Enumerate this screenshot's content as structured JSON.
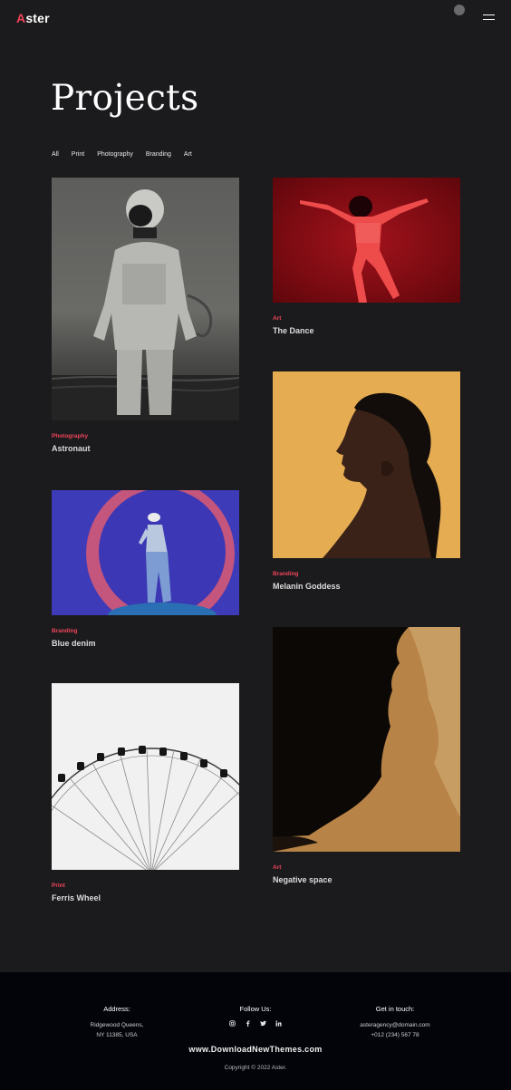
{
  "header": {
    "logo_first": "A",
    "logo_rest": "ster"
  },
  "page": {
    "title": "Projects"
  },
  "filters": [
    "All",
    "Print",
    "Photography",
    "Branding",
    "Art"
  ],
  "projects": [
    {
      "category": "Photography",
      "name": "Astronaut"
    },
    {
      "category": "Art",
      "name": "The Dance"
    },
    {
      "category": "Branding",
      "name": "Melanin Goddess"
    },
    {
      "category": "Branding",
      "name": "Blue denim"
    },
    {
      "category": "Print",
      "name": "Ferris Wheel"
    },
    {
      "category": "Art",
      "name": "Negative space"
    }
  ],
  "footer": {
    "address": {
      "heading": "Address:",
      "line1": "Ridgewood Queens,",
      "line2": "NY 11385, USA"
    },
    "follow": {
      "heading": "Follow Us:"
    },
    "contact": {
      "heading": "Get in touch:",
      "email": "asteragency@domain.com",
      "phone": "+012 (234) 567 78"
    },
    "watermark": "www.DownloadNewThemes.com",
    "copyright": "Copyright © 2022 Aster."
  },
  "icons": {
    "social": [
      "instagram-icon",
      "facebook-icon",
      "twitter-icon",
      "linkedin-icon"
    ]
  },
  "colors": {
    "accent": "#f0455a",
    "background": "#1b1b1d",
    "footer": "#03040a"
  }
}
